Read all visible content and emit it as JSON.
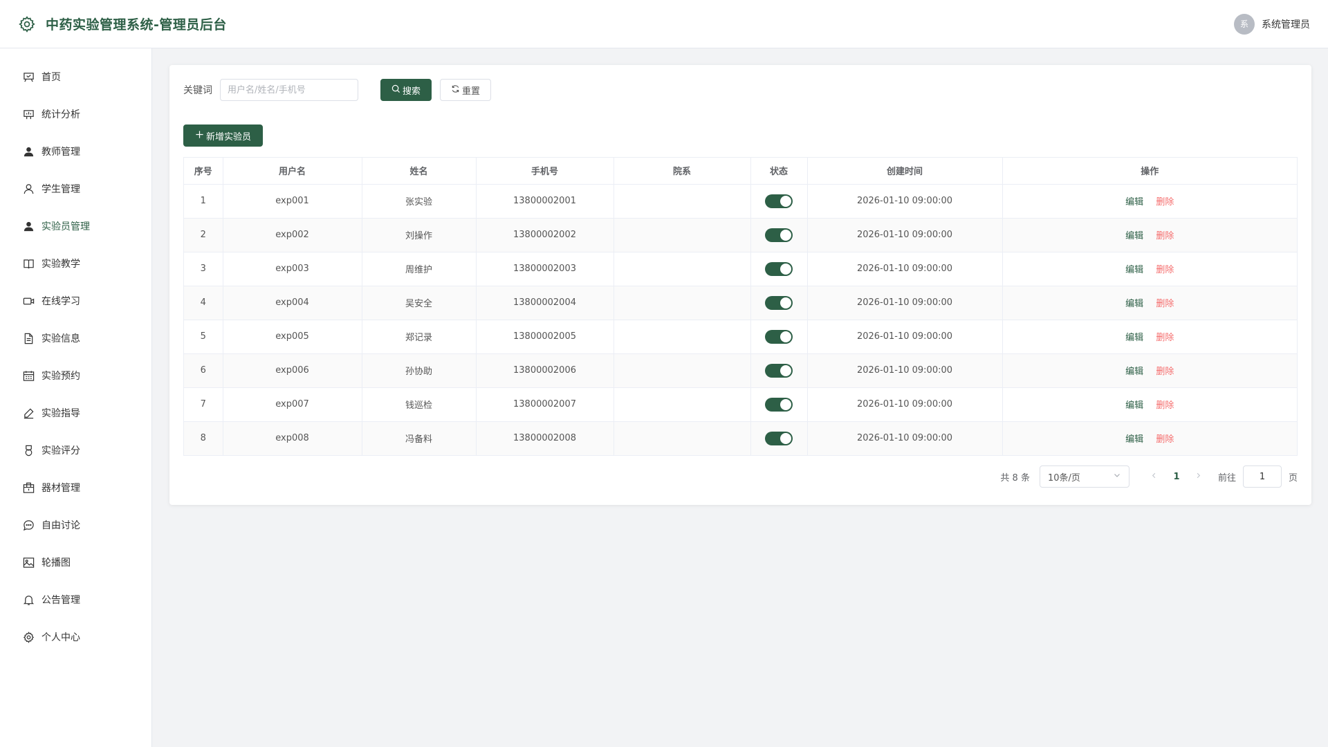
{
  "header": {
    "title": "中药实验管理系统-管理员后台",
    "avatar_text": "系",
    "user_name": "系统管理员"
  },
  "sidebar": {
    "items": [
      {
        "label": "首页",
        "icon": "home-icon"
      },
      {
        "label": "统计分析",
        "icon": "chart-icon"
      },
      {
        "label": "教师管理",
        "icon": "user-filled-icon"
      },
      {
        "label": "学生管理",
        "icon": "user-icon"
      },
      {
        "label": "实验员管理",
        "icon": "user-filled-icon"
      },
      {
        "label": "实验教学",
        "icon": "book-icon"
      },
      {
        "label": "在线学习",
        "icon": "video-icon"
      },
      {
        "label": "实验信息",
        "icon": "document-icon"
      },
      {
        "label": "实验预约",
        "icon": "calendar-icon"
      },
      {
        "label": "实验指导",
        "icon": "edit-pen-icon"
      },
      {
        "label": "实验评分",
        "icon": "medal-icon"
      },
      {
        "label": "器材管理",
        "icon": "box-icon"
      },
      {
        "label": "自由讨论",
        "icon": "chat-icon"
      },
      {
        "label": "轮播图",
        "icon": "picture-icon"
      },
      {
        "label": "公告管理",
        "icon": "bell-icon"
      },
      {
        "label": "个人中心",
        "icon": "setting-icon"
      }
    ],
    "active_index": 4
  },
  "search": {
    "label": "关键词",
    "placeholder": "用户名/姓名/手机号",
    "value": "",
    "search_label": "搜索",
    "reset_label": "重置"
  },
  "toolbar": {
    "add_label": "新增实验员"
  },
  "table": {
    "columns": [
      "序号",
      "用户名",
      "姓名",
      "手机号",
      "院系",
      "状态",
      "创建时间",
      "操作"
    ],
    "rows": [
      {
        "index": "1",
        "username": "exp001",
        "name": "张实验",
        "phone": "13800002001",
        "dept": "",
        "status": true,
        "created": "2026-01-10 09:00:00"
      },
      {
        "index": "2",
        "username": "exp002",
        "name": "刘操作",
        "phone": "13800002002",
        "dept": "",
        "status": true,
        "created": "2026-01-10 09:00:00"
      },
      {
        "index": "3",
        "username": "exp003",
        "name": "周维护",
        "phone": "13800002003",
        "dept": "",
        "status": true,
        "created": "2026-01-10 09:00:00"
      },
      {
        "index": "4",
        "username": "exp004",
        "name": "吴安全",
        "phone": "13800002004",
        "dept": "",
        "status": true,
        "created": "2026-01-10 09:00:00"
      },
      {
        "index": "5",
        "username": "exp005",
        "name": "郑记录",
        "phone": "13800002005",
        "dept": "",
        "status": true,
        "created": "2026-01-10 09:00:00"
      },
      {
        "index": "6",
        "username": "exp006",
        "name": "孙协助",
        "phone": "13800002006",
        "dept": "",
        "status": true,
        "created": "2026-01-10 09:00:00"
      },
      {
        "index": "7",
        "username": "exp007",
        "name": "钱巡检",
        "phone": "13800002007",
        "dept": "",
        "status": true,
        "created": "2026-01-10 09:00:00"
      },
      {
        "index": "8",
        "username": "exp008",
        "name": "冯备料",
        "phone": "13800002008",
        "dept": "",
        "status": true,
        "created": "2026-01-10 09:00:00"
      }
    ],
    "edit_label": "编辑",
    "delete_label": "删除"
  },
  "pagination": {
    "total_text": "共 8 条",
    "page_size": "10条/页",
    "current_page": "1",
    "goto_label": "前往",
    "goto_value": "1",
    "page_suffix": "页"
  },
  "colors": {
    "primary": "#2d5f46",
    "danger": "#f56c6c"
  }
}
